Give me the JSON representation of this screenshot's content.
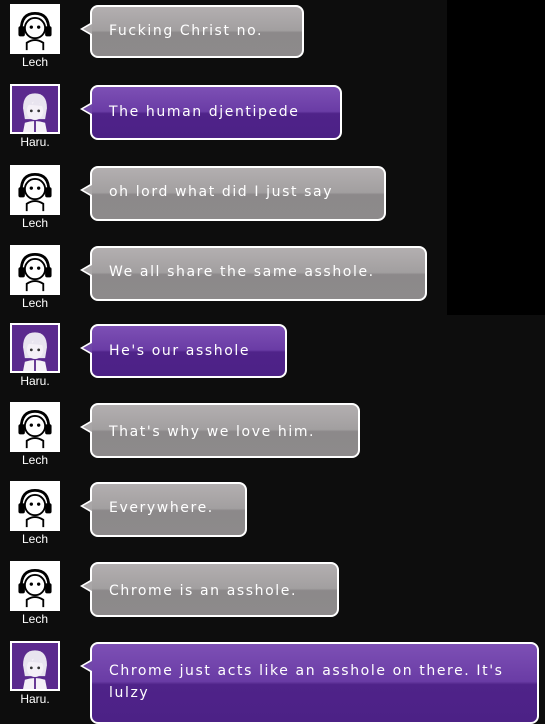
{
  "messages": [
    {
      "speaker": "Lech",
      "text": "Fucking Christ no.",
      "style": "gray"
    },
    {
      "speaker": "Haru.",
      "text": "The human djentipede",
      "style": "purple"
    },
    {
      "speaker": "Lech",
      "text": "oh lord what did I just say",
      "style": "gray"
    },
    {
      "speaker": "Lech",
      "text": "We all share the same asshole.",
      "style": "gray"
    },
    {
      "speaker": "Haru.",
      "text": "He's our asshole",
      "style": "purple"
    },
    {
      "speaker": "Lech",
      "text": "That's why we love him.",
      "style": "gray"
    },
    {
      "speaker": "Lech",
      "text": "Everywhere.",
      "style": "gray"
    },
    {
      "speaker": "Lech",
      "text": "Chrome is an asshole.",
      "style": "gray"
    },
    {
      "speaker": "Haru.",
      "text": "Chrome just acts like an asshole on there. It's lulzy",
      "style": "purple"
    }
  ],
  "colors": {
    "gray_bubble": "#a29fa0",
    "purple_bubble": "#5f32a0",
    "background": "#0d0d0d"
  }
}
